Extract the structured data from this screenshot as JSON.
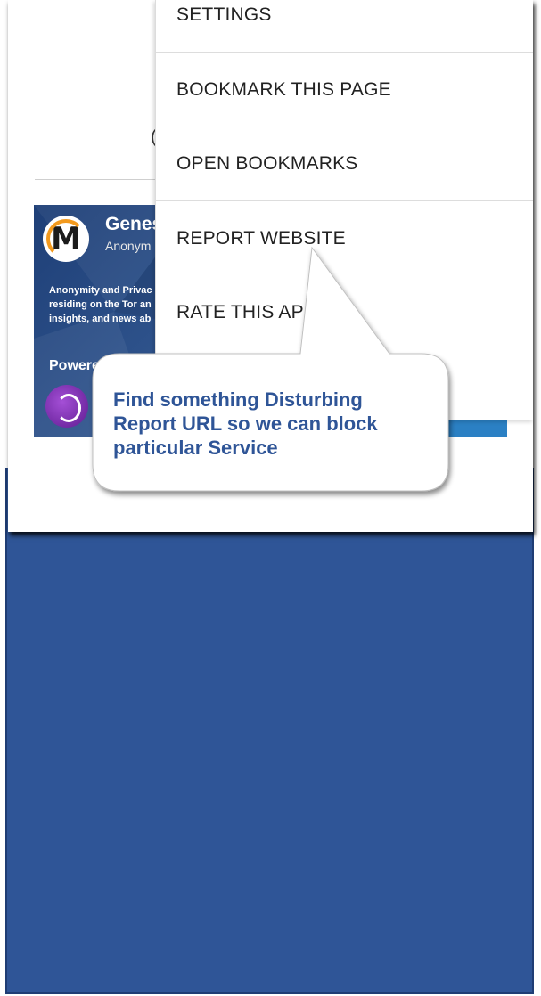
{
  "background_color": "#2f5597",
  "page": {
    "cut_text": "(",
    "banner": {
      "logo_icon": "m-logo-icon",
      "title": "Genes",
      "subtitle": "Anonym",
      "description": [
        "Anonymity and Privac",
        "residing on the Tor an",
        "insights, and news ab"
      ],
      "powered": "Powere",
      "tor_icon": "tor-onion-icon"
    }
  },
  "menu": {
    "items": [
      {
        "label": "SETTINGS"
      },
      {
        "label": "BOOKMARK THIS PAGE"
      },
      {
        "label": "OPEN BOOKMARKS"
      },
      {
        "label": "REPORT WEBSITE"
      },
      {
        "label": "RATE THIS AP"
      }
    ]
  },
  "callout": {
    "lines": [
      "Find something Disturbing",
      "Report URL so we can block",
      "particular Service"
    ],
    "text_color": "#2f5597"
  }
}
